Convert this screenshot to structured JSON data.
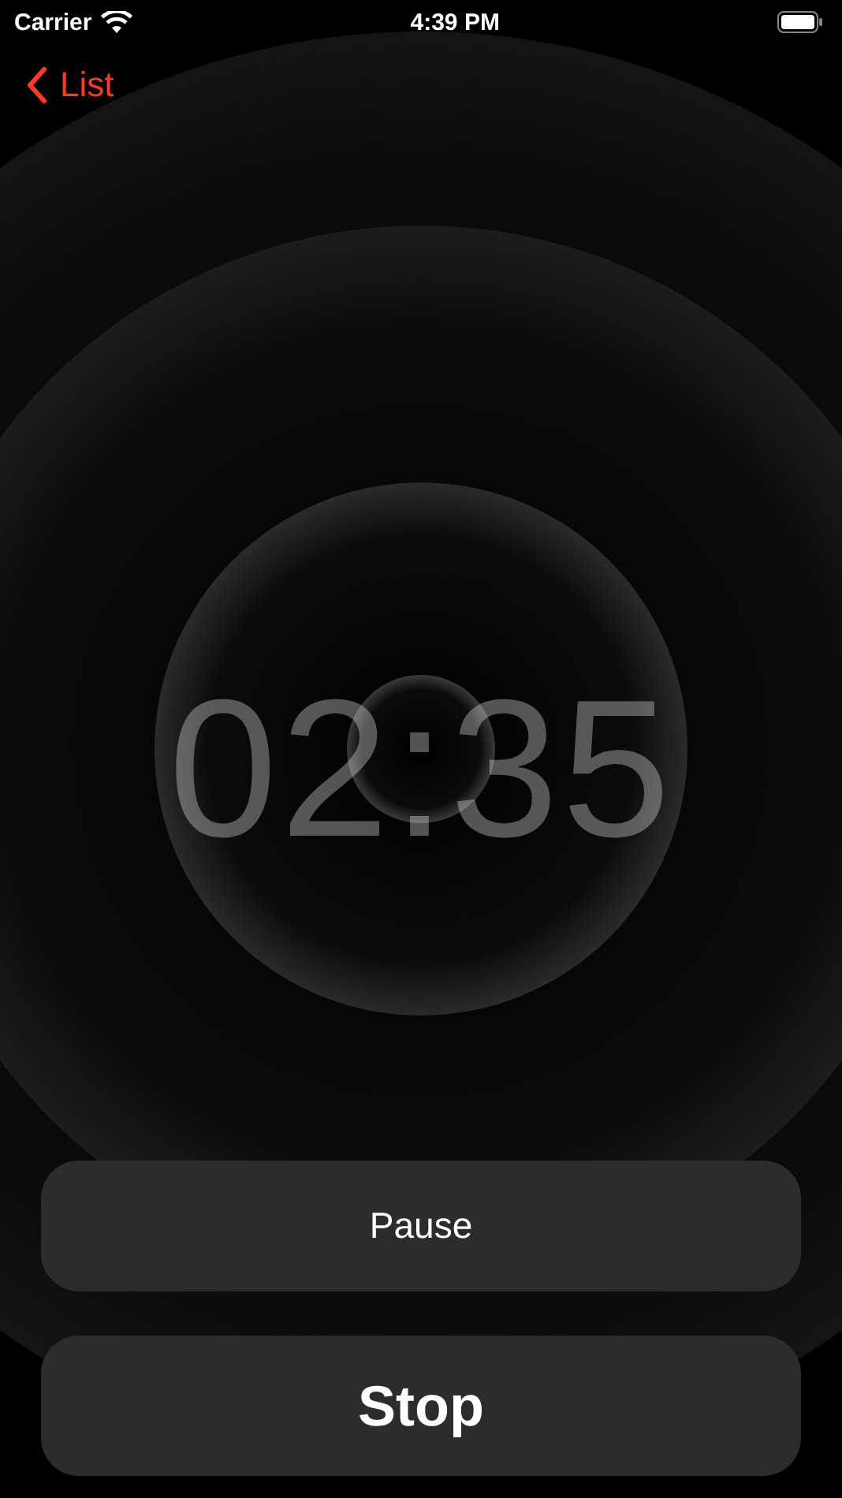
{
  "status_bar": {
    "carrier": "Carrier",
    "time": "4:39 PM"
  },
  "nav": {
    "back_label": "List"
  },
  "timer": {
    "display": "02:35"
  },
  "buttons": [
    {
      "label": "Pause",
      "kind": "secondary"
    },
    {
      "label": "Stop",
      "kind": "primary"
    }
  ]
}
